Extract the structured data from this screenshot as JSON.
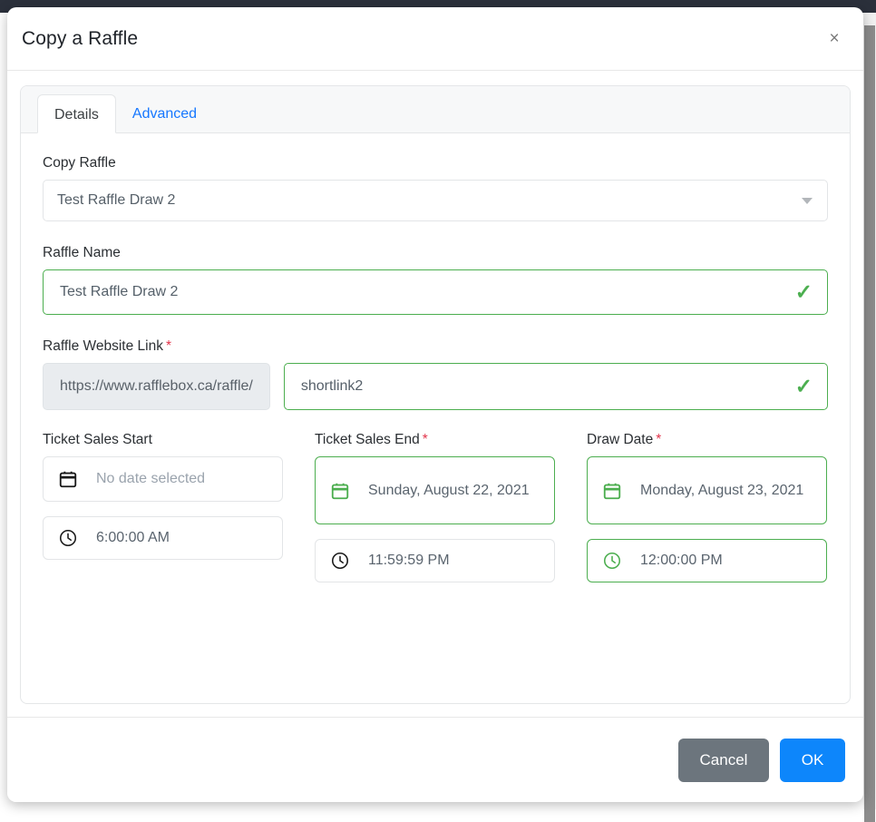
{
  "modal": {
    "title": "Copy a Raffle",
    "close_icon": "close-icon",
    "close_label": "×"
  },
  "tabs": [
    {
      "label": "Details",
      "active": true
    },
    {
      "label": "Advanced",
      "active": false
    }
  ],
  "form": {
    "copy_raffle": {
      "label": "Copy Raffle",
      "value": "Test Raffle Draw 2",
      "caret_icon": "chevron-down-icon"
    },
    "raffle_name": {
      "label": "Raffle Name",
      "value": "Test Raffle Draw 2",
      "valid_icon": "check-icon",
      "valid_glyph": "✓"
    },
    "website_link": {
      "label": "Raffle Website Link",
      "required_marker": "*",
      "prefix": "https://www.rafflebox.ca/raffle/",
      "value": "shortlink2",
      "valid_icon": "check-icon",
      "valid_glyph": "✓"
    },
    "ticket_sales_start": {
      "label": "Ticket Sales Start",
      "required_marker": "",
      "date_placeholder": "No date selected",
      "date_value": "",
      "time_value": "6:00:00 AM",
      "calendar_icon": "calendar-icon",
      "clock_icon": "clock-icon",
      "date_state": "empty",
      "time_state": "neutral"
    },
    "ticket_sales_end": {
      "label": "Ticket Sales End",
      "required_marker": "*",
      "date_value": "Sunday, August 22, 2021",
      "time_value": "11:59:59 PM",
      "calendar_icon": "calendar-icon",
      "clock_icon": "clock-icon",
      "date_state": "valid",
      "time_state": "neutral"
    },
    "draw_date": {
      "label": "Draw Date",
      "required_marker": "*",
      "date_value": "Monday, August 23, 2021",
      "time_value": "12:00:00 PM",
      "calendar_icon": "calendar-icon",
      "clock_icon": "clock-icon",
      "date_state": "valid",
      "time_state": "valid"
    }
  },
  "footer": {
    "cancel_label": "Cancel",
    "ok_label": "OK"
  },
  "colors": {
    "accent_blue": "#0d86fb",
    "tab_link_blue": "#1677ff",
    "valid_green": "#4cae4f",
    "required_red": "#e2344b",
    "cancel_gray": "#6c757d",
    "backdrop": "#2b303b"
  }
}
